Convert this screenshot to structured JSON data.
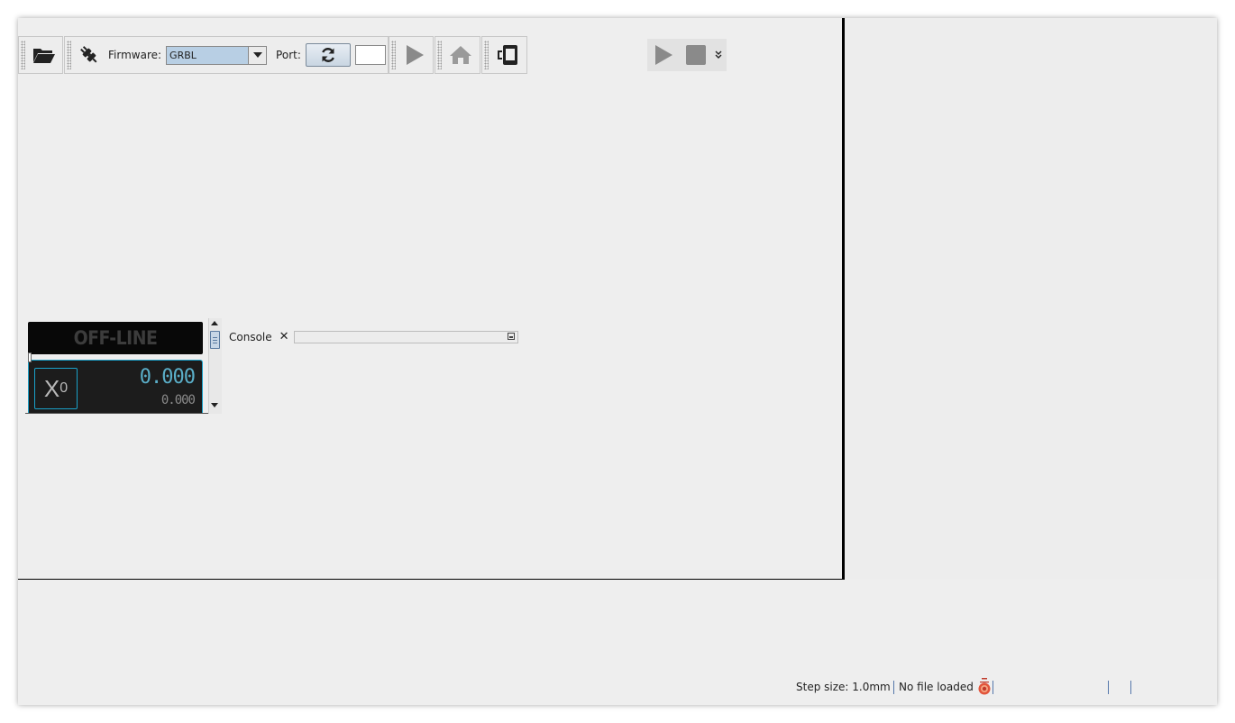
{
  "toolbar": {
    "firmware_label": "Firmware:",
    "firmware_value": "GRBL",
    "port_label": "Port:",
    "port_value": ""
  },
  "dro": {
    "status": "OFF-LINE",
    "axis_letter": "X",
    "axis_sub": "0",
    "work_position": "0.000",
    "machine_position": "0.000"
  },
  "console": {
    "tab_label": "Console",
    "close_glyph": "✕"
  },
  "statusbar": {
    "step_size": "Step size: 1.0mm",
    "file_status": "No file loaded"
  },
  "icons": {
    "open": "folder-open-icon",
    "connect": "plug-icon",
    "refresh": "refresh-icon",
    "send": "play-icon",
    "home": "home-icon",
    "device": "device-icon",
    "run": "play-icon",
    "stop": "stop-icon",
    "overflow": "chevron-double-down-icon"
  },
  "colors": {
    "accent": "#1aa0c8",
    "dro_value": "#5aaec8",
    "dro_background": "#1c1c1c",
    "selection": "#b8cfe4"
  }
}
